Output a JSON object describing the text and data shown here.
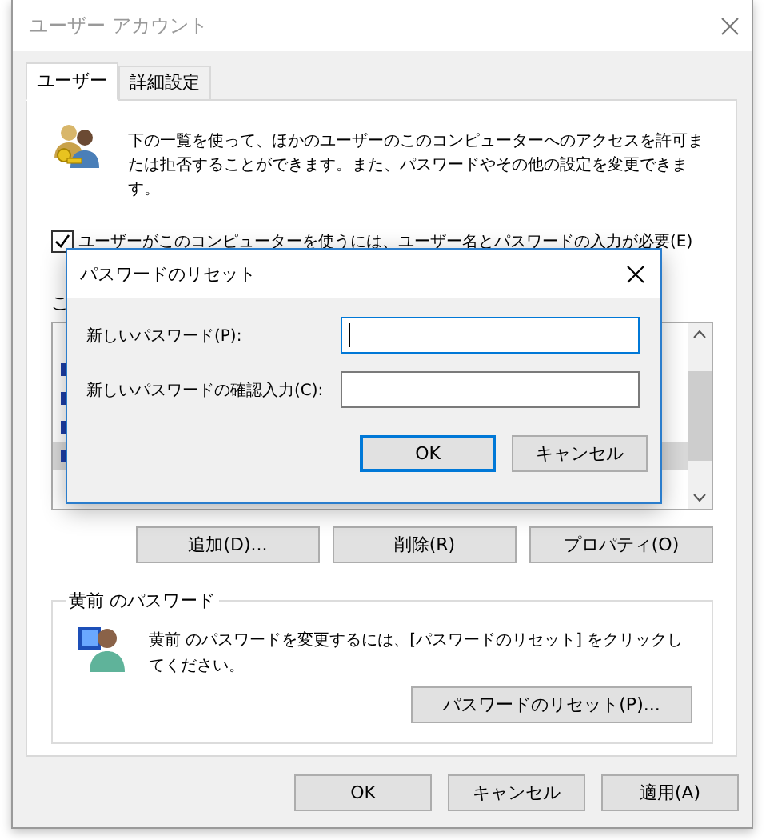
{
  "window": {
    "title": "ユーザー アカウント"
  },
  "tabs": [
    {
      "label": "ユーザー",
      "selected": true
    },
    {
      "label": "詳細設定",
      "selected": false
    }
  ],
  "intro": "下の一覧を使って、ほかのユーザーのこのコンピューターへのアクセスを許可または拒否することができます。また、パスワードやその他の設定を変更できます。",
  "require_password": {
    "label": "ユーザーがこのコンピューターを使うには、ユーザー名とパスワードの入力が必要(E)",
    "checked": true
  },
  "users_list": {
    "label": "こ",
    "rows": [
      {
        "selected": false
      },
      {
        "selected": false
      },
      {
        "selected": false
      },
      {
        "selected": true
      }
    ]
  },
  "list_buttons": [
    "追加(D)...",
    "削除(R)",
    "プロパティ(O)"
  ],
  "password_group": {
    "title": "黄前 のパスワード",
    "message": "黄前 のパスワードを変更するには、[パスワードのリセット] をクリックしてください。",
    "button": "パスワードのリセット(P)..."
  },
  "buttons": [
    "OK",
    "キャンセル",
    "適用(A)"
  ],
  "dialog": {
    "title": "パスワードのリセット",
    "fields": [
      {
        "label": "新しいパスワード(P):",
        "focused": true
      },
      {
        "label": "新しいパスワードの確認入力(C):",
        "focused": false
      }
    ],
    "buttons": [
      {
        "label": "OK",
        "default": true
      },
      {
        "label": "キャンセル",
        "default": false
      }
    ]
  }
}
